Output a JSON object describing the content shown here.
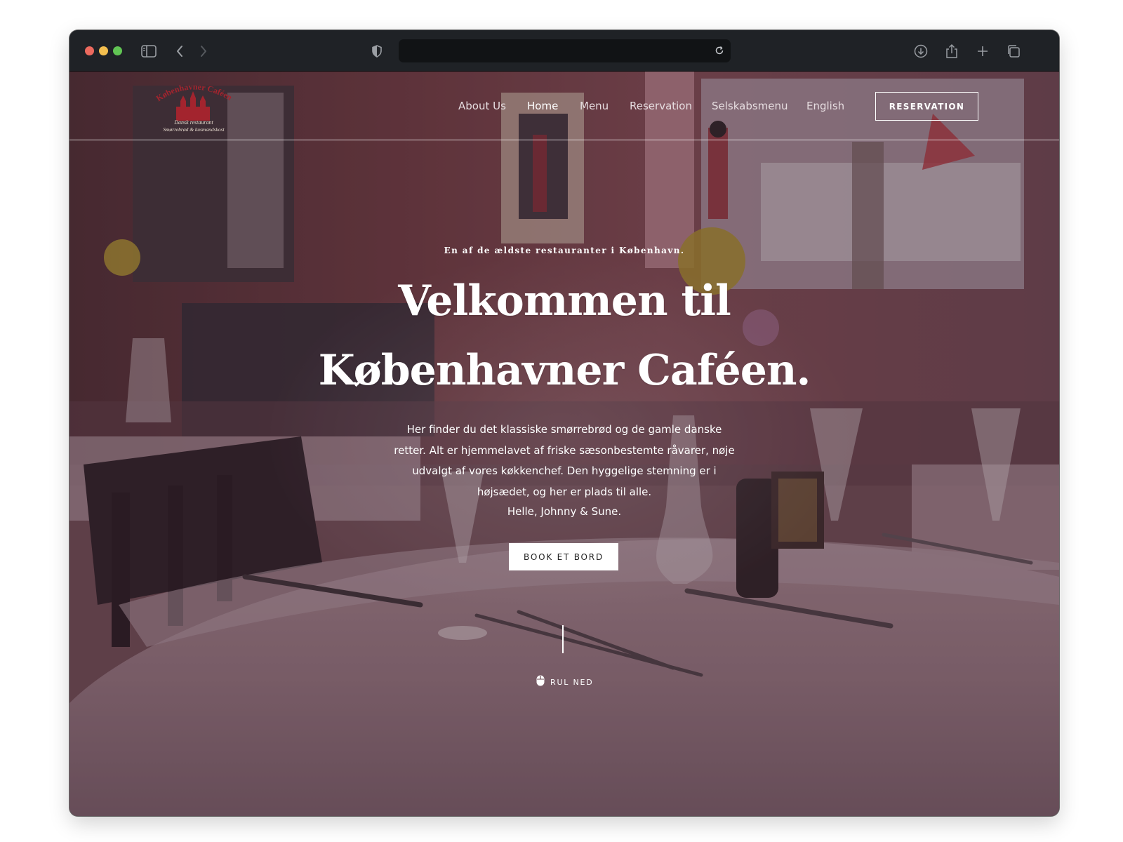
{
  "browser": {
    "url": ""
  },
  "site": {
    "logo": {
      "arc_text": "Københavner Caféen",
      "line1": "Dansk restaurant",
      "line2": "Smørrebrød & kusmandskost"
    },
    "nav": {
      "items": [
        "About Us",
        "Home",
        "Menu",
        "Reservation",
        "Selskabsmenu",
        "English"
      ],
      "active": "Home",
      "cta_label": "RESERVATION"
    },
    "hero": {
      "tagline": "En af de ældste restauranter i København.",
      "title_line1": "Velkommen til",
      "title_line2": "Københavner Caféen.",
      "body_lines": [
        "Her finder du det klassiske smørrebrød og de gamle danske",
        "retter. Alt er hjemmelavet af friske sæsonbestemte råvarer, nøje",
        "udvalgt af vores køkkenchef. Den hyggelige stemning er i",
        "højsædet, og her er plads til alle."
      ],
      "signature": "Helle, Johnny & Sune.",
      "button_label": "BOOK ET BORD",
      "scroll_label": "RUL NED"
    }
  },
  "colors": {
    "overlay": "#3c1e2d",
    "logo_red": "#a3242e",
    "button_bg": "#ffffff",
    "text": "#ffffff"
  }
}
